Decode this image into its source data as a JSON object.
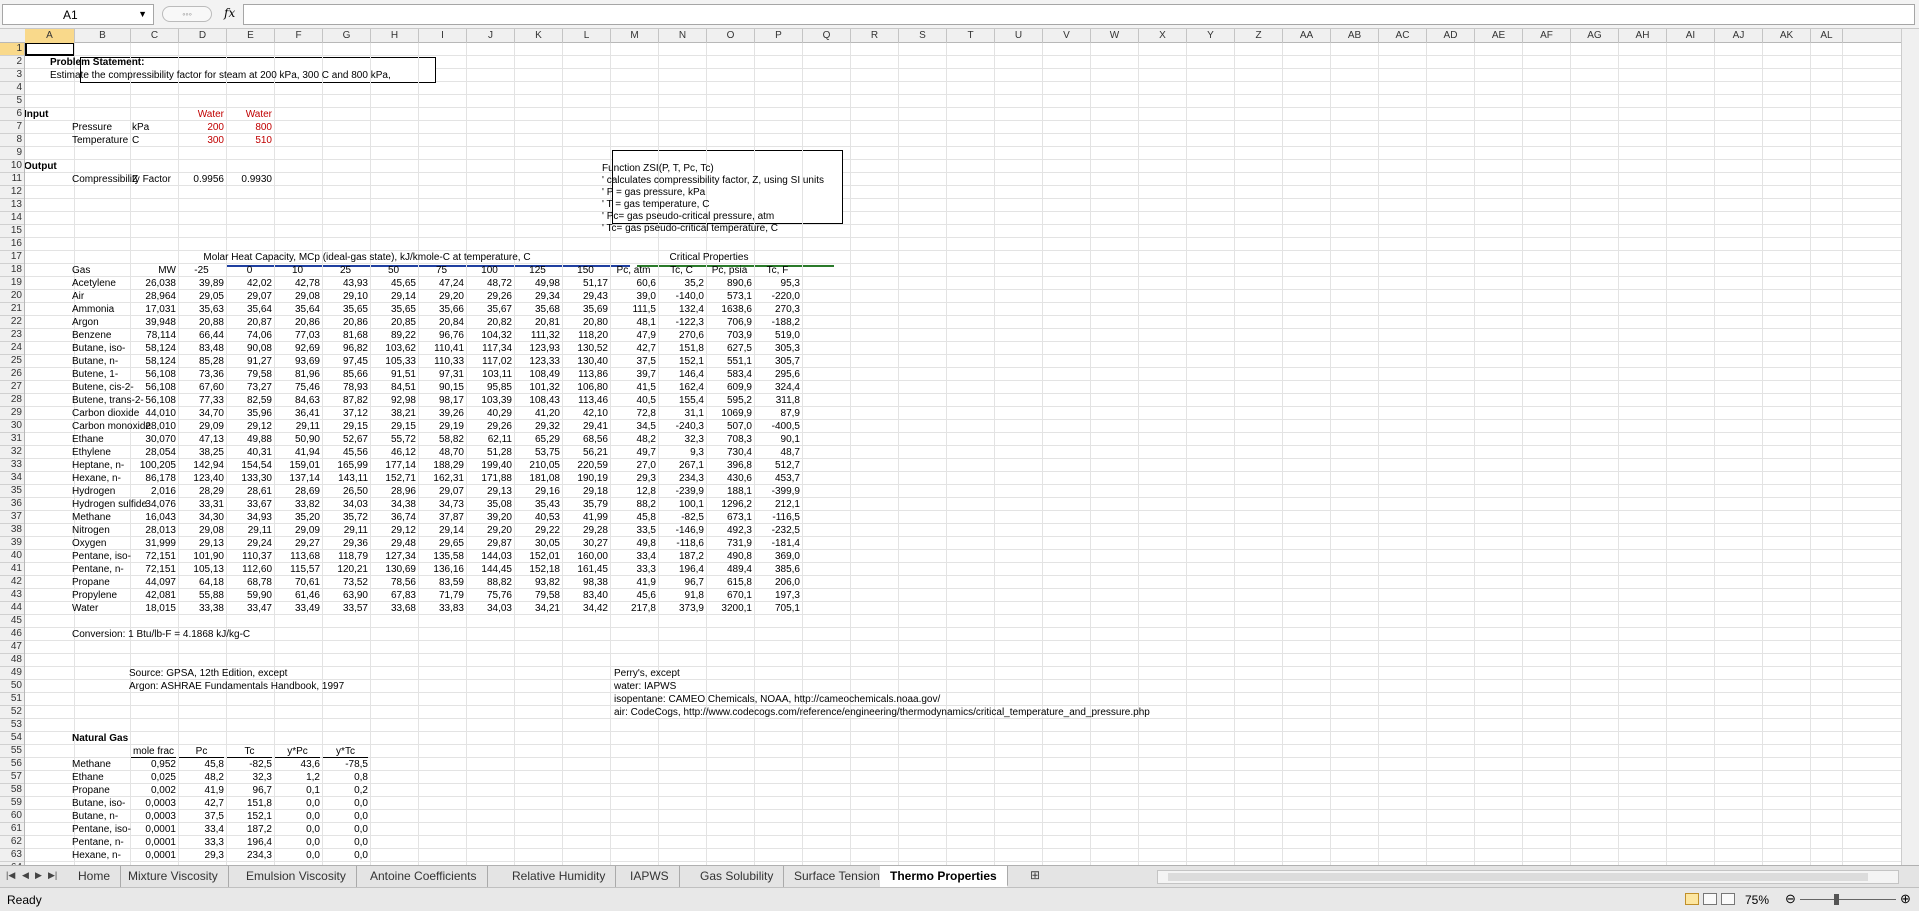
{
  "formula_bar": {
    "name_box": "A1",
    "fx_label": "fx",
    "formula": ""
  },
  "columns": [
    "A",
    "B",
    "C",
    "D",
    "E",
    "F",
    "G",
    "H",
    "I",
    "J",
    "K",
    "L",
    "M",
    "N",
    "O",
    "P",
    "Q",
    "R",
    "S",
    "T",
    "U",
    "V",
    "W",
    "X",
    "Y",
    "Z",
    "AA",
    "AB",
    "AC",
    "AD",
    "AE",
    "AF",
    "AG",
    "AH",
    "AI",
    "AJ",
    "AK",
    "AL"
  ],
  "problem": {
    "title": "Problem Statement:",
    "text": "Estimate the compressibility factor for steam at 200 kPa, 300 C and 800 kPa,"
  },
  "input": {
    "label": "Input",
    "col1": "Water",
    "col2": "Water",
    "pressure_label": "Pressure",
    "pressure_unit": "kPa",
    "p1": "200",
    "p2": "800",
    "temp_label": "Temperature",
    "temp_unit": "C",
    "t1": "300",
    "t2": "510"
  },
  "output": {
    "label": "Output",
    "z_label": "Compressibility Factor",
    "z_unit": "Z",
    "z1": "0.9956",
    "z2": "0.9930"
  },
  "function_box": [
    "Function ZSI(P, T, Pc, Tc)",
    "' calculates compressibility factor, Z, using SI units",
    "' P = gas pressure, kPa",
    "' T = gas temperature, C",
    "' Pc= gas pseudo-critical pressure, atm",
    "' Tc= gas pseudo-critical temperature, C"
  ],
  "table": {
    "heat_header": "Molar Heat Capacity, MCp (ideal-gas state), kJ/kmole-C at temperature, C",
    "crit_header": "Critical Properties",
    "cols": [
      "Gas",
      "MW",
      "-25",
      "0",
      "10",
      "25",
      "50",
      "75",
      "100",
      "125",
      "150",
      "Pc, atm",
      "Tc, C",
      "Pc, psia",
      "Tc, F"
    ],
    "rows": [
      [
        "Acetylene",
        "26,038",
        "39,89",
        "42,02",
        "42,78",
        "43,93",
        "45,65",
        "47,24",
        "48,72",
        "49,98",
        "51,17",
        "60,6",
        "35,2",
        "890,6",
        "95,3"
      ],
      [
        "Air",
        "28,964",
        "29,05",
        "29,07",
        "29,08",
        "29,10",
        "29,14",
        "29,20",
        "29,26",
        "29,34",
        "29,43",
        "39,0",
        "-140,0",
        "573,1",
        "-220,0"
      ],
      [
        "Ammonia",
        "17,031",
        "35,63",
        "35,64",
        "35,64",
        "35,65",
        "35,65",
        "35,66",
        "35,67",
        "35,68",
        "35,69",
        "111,5",
        "132,4",
        "1638,6",
        "270,3"
      ],
      [
        "Argon",
        "39,948",
        "20,88",
        "20,87",
        "20,86",
        "20,86",
        "20,85",
        "20,84",
        "20,82",
        "20,81",
        "20,80",
        "48,1",
        "-122,3",
        "706,9",
        "-188,2"
      ],
      [
        "Benzene",
        "78,114",
        "66,44",
        "74,06",
        "77,03",
        "81,68",
        "89,22",
        "96,76",
        "104,32",
        "111,32",
        "118,20",
        "47,9",
        "270,6",
        "703,9",
        "519,0"
      ],
      [
        "Butane, iso-",
        "58,124",
        "83,48",
        "90,08",
        "92,69",
        "96,82",
        "103,62",
        "110,41",
        "117,34",
        "123,93",
        "130,52",
        "42,7",
        "151,8",
        "627,5",
        "305,3"
      ],
      [
        "Butane, n-",
        "58,124",
        "85,28",
        "91,27",
        "93,69",
        "97,45",
        "105,33",
        "110,33",
        "117,02",
        "123,33",
        "130,40",
        "37,5",
        "152,1",
        "551,1",
        "305,7"
      ],
      [
        "Butene, 1-",
        "56,108",
        "73,36",
        "79,58",
        "81,96",
        "85,66",
        "91,51",
        "97,31",
        "103,11",
        "108,49",
        "113,86",
        "39,7",
        "146,4",
        "583,4",
        "295,6"
      ],
      [
        "Butene, cis-2-",
        "56,108",
        "67,60",
        "73,27",
        "75,46",
        "78,93",
        "84,51",
        "90,15",
        "95,85",
        "101,32",
        "106,80",
        "41,5",
        "162,4",
        "609,9",
        "324,4"
      ],
      [
        "Butene, trans-2-",
        "56,108",
        "77,33",
        "82,59",
        "84,63",
        "87,82",
        "92,98",
        "98,17",
        "103,39",
        "108,43",
        "113,46",
        "40,5",
        "155,4",
        "595,2",
        "311,8"
      ],
      [
        "Carbon dioxide",
        "44,010",
        "34,70",
        "35,96",
        "36,41",
        "37,12",
        "38,21",
        "39,26",
        "40,29",
        "41,20",
        "42,10",
        "72,8",
        "31,1",
        "1069,9",
        "87,9"
      ],
      [
        "Carbon monoxide",
        "28,010",
        "29,09",
        "29,12",
        "29,11",
        "29,15",
        "29,15",
        "29,19",
        "29,26",
        "29,32",
        "29,41",
        "34,5",
        "-240,3",
        "507,0",
        "-400,5"
      ],
      [
        "Ethane",
        "30,070",
        "47,13",
        "49,88",
        "50,90",
        "52,67",
        "55,72",
        "58,82",
        "62,11",
        "65,29",
        "68,56",
        "48,2",
        "32,3",
        "708,3",
        "90,1"
      ],
      [
        "Ethylene",
        "28,054",
        "38,25",
        "40,31",
        "41,94",
        "45,56",
        "46,12",
        "48,70",
        "51,28",
        "53,75",
        "56,21",
        "49,7",
        "9,3",
        "730,4",
        "48,7"
      ],
      [
        "Heptane, n-",
        "100,205",
        "142,94",
        "154,54",
        "159,01",
        "165,99",
        "177,14",
        "188,29",
        "199,40",
        "210,05",
        "220,59",
        "27,0",
        "267,1",
        "396,8",
        "512,7"
      ],
      [
        "Hexane, n-",
        "86,178",
        "123,40",
        "133,30",
        "137,14",
        "143,11",
        "152,71",
        "162,31",
        "171,88",
        "181,08",
        "190,19",
        "29,3",
        "234,3",
        "430,6",
        "453,7"
      ],
      [
        "Hydrogen",
        "2,016",
        "28,29",
        "28,61",
        "28,69",
        "26,50",
        "28,96",
        "29,07",
        "29,13",
        "29,16",
        "29,18",
        "12,8",
        "-239,9",
        "188,1",
        "-399,9"
      ],
      [
        "Hydrogen sulfide",
        "34,076",
        "33,31",
        "33,67",
        "33,82",
        "34,03",
        "34,38",
        "34,73",
        "35,08",
        "35,43",
        "35,79",
        "88,2",
        "100,1",
        "1296,2",
        "212,1"
      ],
      [
        "Methane",
        "16,043",
        "34,30",
        "34,93",
        "35,20",
        "35,72",
        "36,74",
        "37,87",
        "39,20",
        "40,53",
        "41,99",
        "45,8",
        "-82,5",
        "673,1",
        "-116,5"
      ],
      [
        "Nitrogen",
        "28,013",
        "29,08",
        "29,11",
        "29,09",
        "29,11",
        "29,12",
        "29,14",
        "29,20",
        "29,22",
        "29,28",
        "33,5",
        "-146,9",
        "492,3",
        "-232,5"
      ],
      [
        "Oxygen",
        "31,999",
        "29,13",
        "29,24",
        "29,27",
        "29,36",
        "29,48",
        "29,65",
        "29,87",
        "30,05",
        "30,27",
        "49,8",
        "-118,6",
        "731,9",
        "-181,4"
      ],
      [
        "Pentane, iso-",
        "72,151",
        "101,90",
        "110,37",
        "113,68",
        "118,79",
        "127,34",
        "135,58",
        "144,03",
        "152,01",
        "160,00",
        "33,4",
        "187,2",
        "490,8",
        "369,0"
      ],
      [
        "Pentane, n-",
        "72,151",
        "105,13",
        "112,60",
        "115,57",
        "120,21",
        "130,69",
        "136,16",
        "144,45",
        "152,18",
        "161,45",
        "33,3",
        "196,4",
        "489,4",
        "385,6"
      ],
      [
        "Propane",
        "44,097",
        "64,18",
        "68,78",
        "70,61",
        "73,52",
        "78,56",
        "83,59",
        "88,82",
        "93,82",
        "98,38",
        "41,9",
        "96,7",
        "615,8",
        "206,0"
      ],
      [
        "Propylene",
        "42,081",
        "55,88",
        "59,90",
        "61,46",
        "63,90",
        "67,83",
        "71,79",
        "75,76",
        "79,58",
        "83,40",
        "45,6",
        "91,8",
        "670,1",
        "197,3"
      ],
      [
        "Water",
        "18,015",
        "33,38",
        "33,47",
        "33,49",
        "33,57",
        "33,68",
        "33,83",
        "34,03",
        "34,21",
        "34,42",
        "217,8",
        "373,9",
        "3200,1",
        "705,1"
      ]
    ]
  },
  "conversion": "Conversion: 1 Btu/lb-F = 4.1868 kJ/kg-C",
  "sources": {
    "s1": "Source: GPSA, 12th Edition, except",
    "s2": "Argon: ASHRAE Fundamentals Handbook, 1997",
    "p1": "Perry's, except",
    "p2": "water: IAPWS",
    "p3": "isopentane: CAMEO Chemicals, NOAA, http://cameochemicals.noaa.gov/",
    "p4": "air: CodeCogs, http://www.codecogs.com/reference/engineering/thermodynamics/critical_temperature_and_pressure.php"
  },
  "natural_gas": {
    "title": "Natural Gas",
    "cols": [
      "mole frac",
      "Pc",
      "Tc",
      "y*Pc",
      "y*Tc"
    ],
    "rows": [
      [
        "Methane",
        "0,952",
        "45,8",
        "-82,5",
        "43,6",
        "-78,5"
      ],
      [
        "Ethane",
        "0,025",
        "48,2",
        "32,3",
        "1,2",
        "0,8"
      ],
      [
        "Propane",
        "0,002",
        "41,9",
        "96,7",
        "0,1",
        "0,2"
      ],
      [
        "Butane, iso-",
        "0,0003",
        "42,7",
        "151,8",
        "0,0",
        "0,0"
      ],
      [
        "Butane, n-",
        "0,0003",
        "37,5",
        "152,1",
        "0,0",
        "0,0"
      ],
      [
        "Pentane, iso-",
        "0,0001",
        "33,4",
        "187,2",
        "0,0",
        "0,0"
      ],
      [
        "Pentane, n-",
        "0,0001",
        "33,3",
        "196,4",
        "0,0",
        "0,0"
      ],
      [
        "Hexane, n-",
        "0,0001",
        "29,3",
        "234,3",
        "0,0",
        "0,0"
      ]
    ]
  },
  "sheet_tabs": [
    "Home",
    "Mixture Viscosity",
    "Emulsion Viscosity",
    "Antoine Coefficients",
    "Relative Humidity",
    "IAPWS",
    "Gas Solubility",
    "Surface Tension",
    "Thermo Properties"
  ],
  "active_tab": "Thermo Properties",
  "status": {
    "ready": "Ready",
    "zoom": "75%"
  }
}
